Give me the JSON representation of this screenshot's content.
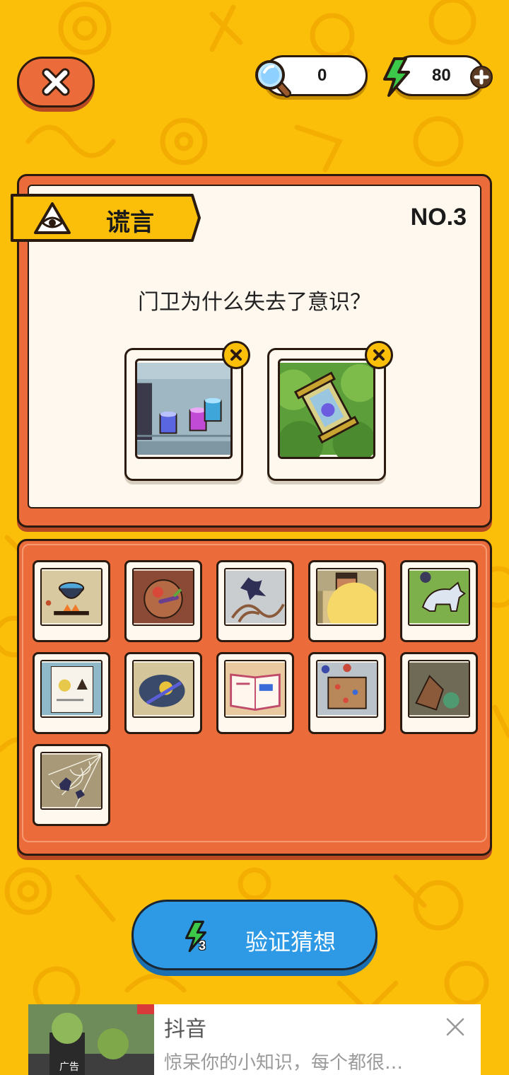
{
  "hud": {
    "magnifier_count": "0",
    "energy_count": "80",
    "icons": [
      "close-icon",
      "magnifier-icon",
      "lightning-icon",
      "plus-icon"
    ]
  },
  "case": {
    "category": "谎言",
    "level": "NO.3",
    "question": "门卫为什么失去了意识？",
    "selected_clues": [
      "candles-on-shelf",
      "lantern-in-bushes"
    ]
  },
  "clues": [
    "cauldron",
    "basket",
    "cat-on-vines",
    "window-peek",
    "wolf-in-field",
    "wanted-poster",
    "magic-map",
    "open-book",
    "gem-map",
    "tree-stump",
    "spider-web"
  ],
  "verify": {
    "label": "验证猜想",
    "cost": "3"
  },
  "ad": {
    "title": "抖音",
    "description": "惊呆你的小知识，每个都很…",
    "thumb_label": "广告"
  },
  "colors": {
    "background": "#FBBF0A",
    "panel": "#EB6B3B",
    "button": "#2E9AE6"
  }
}
